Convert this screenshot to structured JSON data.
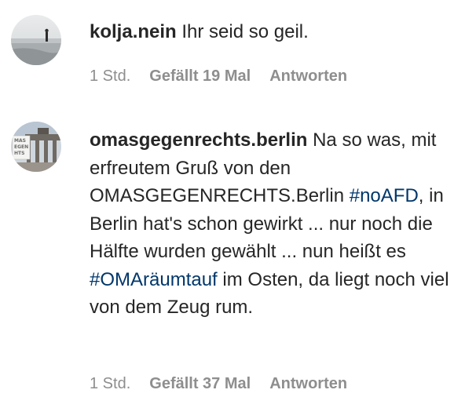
{
  "comments": [
    {
      "username": "kolja.nein",
      "text": "Ihr seid so geil.",
      "time": "1 Std.",
      "likes": "Gefällt 19 Mal",
      "reply_label": "Antworten"
    },
    {
      "username": "omasgegenrechts.berlin",
      "text_1": "Na so was, mit erfreutem Gruß von den OMASGEGENRECHTS.Berlin",
      "hashtag_1": "#noAFD",
      "text_2": ", in Berlin hat's schon gewirkt ... nur noch die Hälfte wurden gewählt ... nun heißt es",
      "hashtag_2": "#OMAräumtauf",
      "text_3": "im Osten, da liegt noch viel von dem Zeug rum.",
      "avatar_sign_text": "OMAS GEGEN RECHTS",
      "time": "1 Std.",
      "likes": "Gefällt 37 Mal",
      "reply_label": "Antworten"
    }
  ],
  "colors": {
    "text": "#262626",
    "meta": "#8e8e8e",
    "hashtag": "#00376b"
  }
}
